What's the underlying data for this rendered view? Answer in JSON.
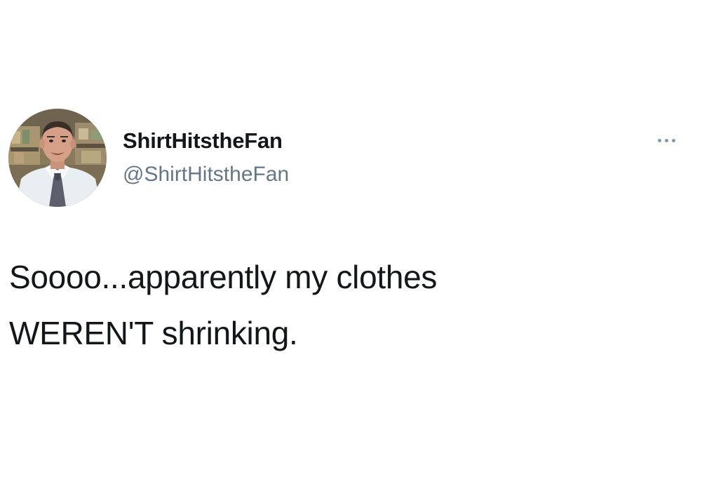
{
  "tweet": {
    "author": {
      "display_name": "ShirtHitstheFan",
      "handle": "@ShirtHitstheFan"
    },
    "text_lines": [
      "Soooo...apparently my clothes",
      "WEREN'T shrinking."
    ],
    "menu_icon": "more-horizontal-icon"
  },
  "colors": {
    "text_primary": "#14171a",
    "text_secondary": "#657786",
    "icon": "#8899a6",
    "background": "#ffffff"
  }
}
